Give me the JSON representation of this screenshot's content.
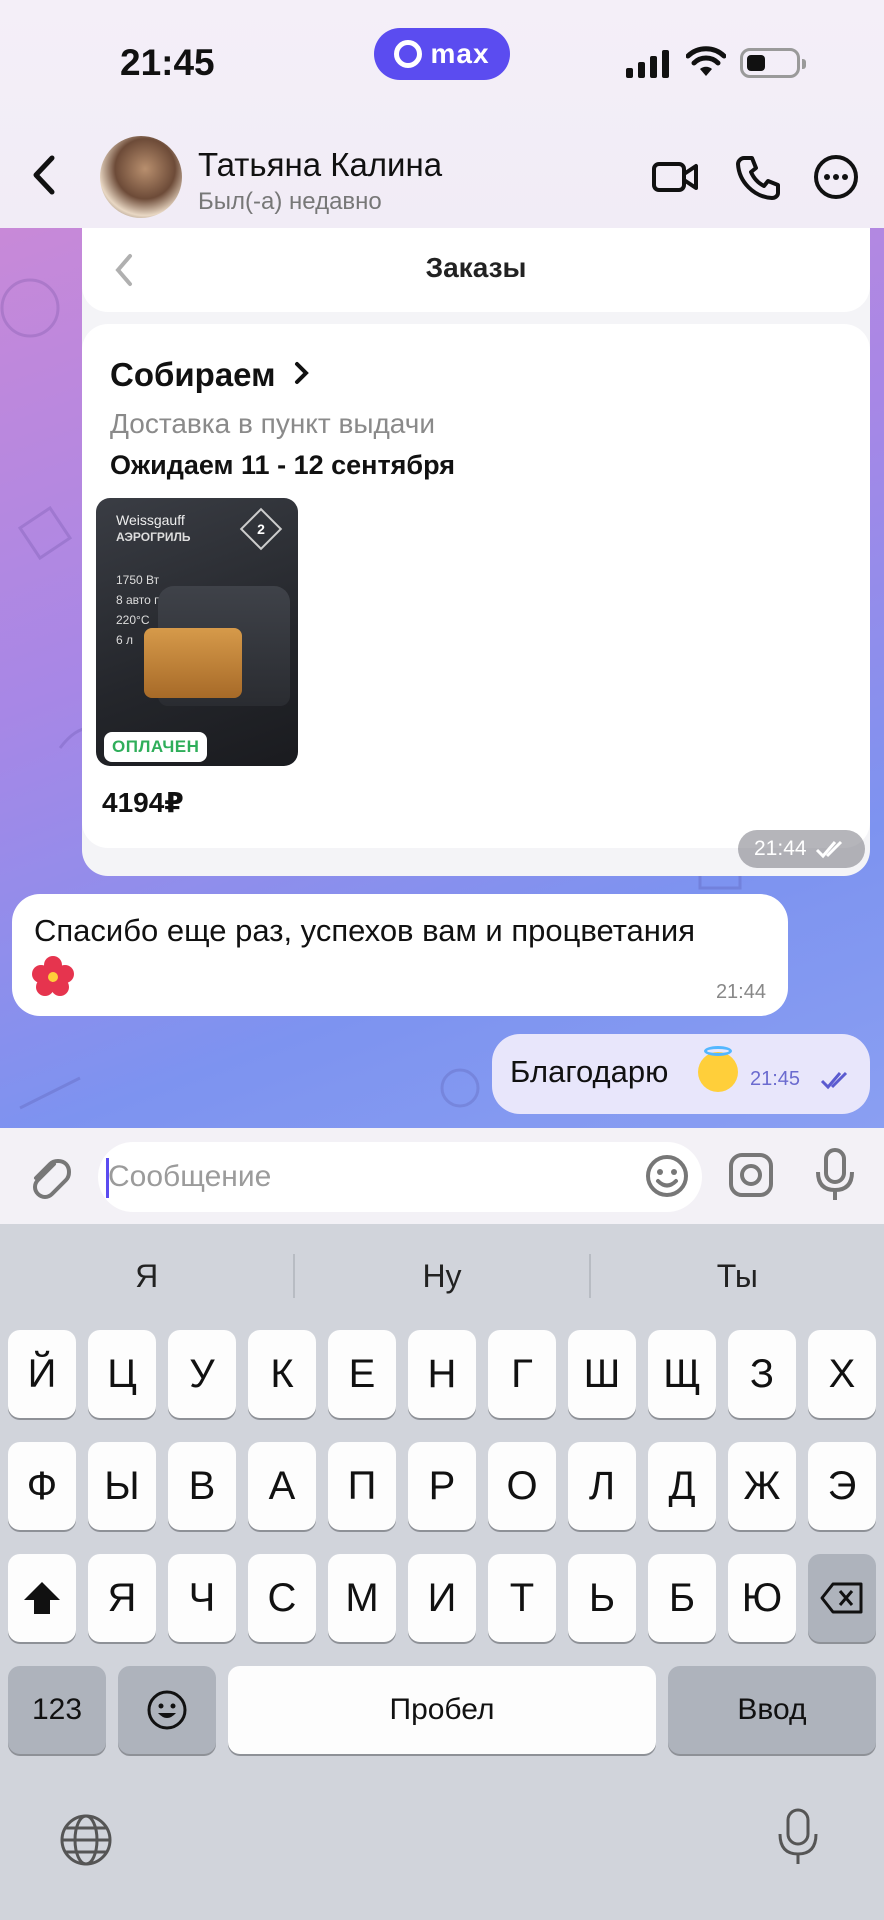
{
  "status_bar": {
    "time": "21:45",
    "app_badge": "max"
  },
  "header": {
    "contact_name": "Татьяна Калина",
    "contact_status": "Был(-а) недавно"
  },
  "order_card": {
    "title": "Заказы",
    "status": "Собираем",
    "delivery_type": "Доставка в пункт выдачи",
    "expected": "Ожидаем 11 - 12 сентября",
    "product": {
      "brand": "Weissgauff",
      "type": "АЭРОГРИЛЬ",
      "spec_1": "1750 Вт",
      "spec_2": "8 авто программ",
      "spec_3": "220°С",
      "spec_4": "6 л",
      "warranty": "2",
      "paid_label": "ОПЛАЧЕН"
    },
    "price": "4194₽",
    "time": "21:44"
  },
  "messages": [
    {
      "direction": "in",
      "text": "Спасибо еще раз, успехов вам и процветания",
      "time": "21:44"
    },
    {
      "direction": "out",
      "text": "Благодарю",
      "time": "21:45"
    }
  ],
  "composer": {
    "placeholder": "Сообщение"
  },
  "keyboard": {
    "suggestions": [
      "Я",
      "Ну",
      "Ты"
    ],
    "row1": [
      "Й",
      "Ц",
      "У",
      "К",
      "Е",
      "Н",
      "Г",
      "Ш",
      "Щ",
      "З",
      "Х"
    ],
    "row2": [
      "Ф",
      "Ы",
      "В",
      "А",
      "П",
      "Р",
      "О",
      "Л",
      "Д",
      "Ж",
      "Э"
    ],
    "row3": [
      "Я",
      "Ч",
      "С",
      "М",
      "И",
      "Т",
      "Ь",
      "Б",
      "Ю"
    ],
    "numbers_key": "123",
    "space_key": "Пробел",
    "enter_key": "Ввод"
  },
  "colors": {
    "accent": "#5b4cf0",
    "paid_green": "#2fae5a",
    "outgoing_bubble": "#e8e6fb"
  }
}
